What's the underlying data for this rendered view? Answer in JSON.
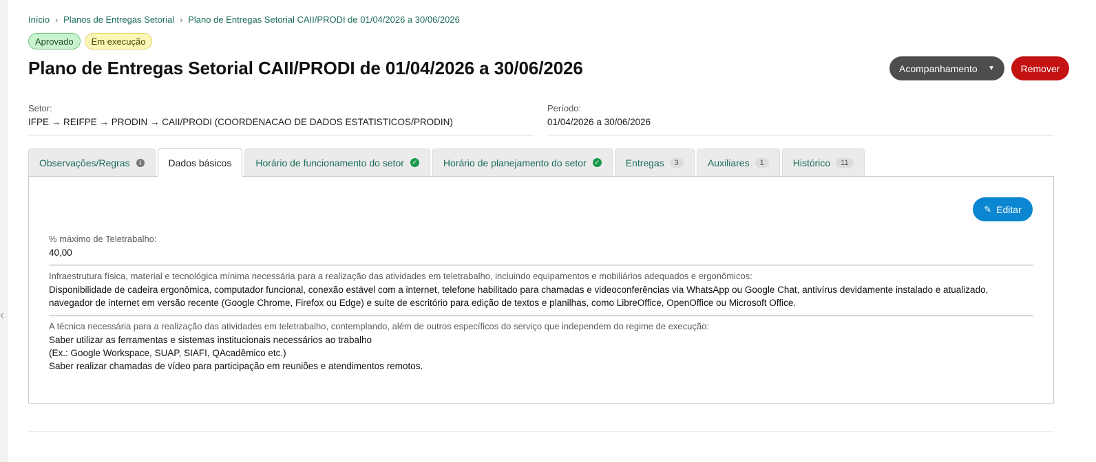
{
  "breadcrumb": {
    "items": [
      "Início",
      "Planos de Entregas Setorial",
      "Plano de Entregas Setorial CAII/PRODI de 01/04/2026 a 30/06/2026"
    ],
    "separator": "›"
  },
  "badges": [
    "Aprovado",
    "Em execução"
  ],
  "page_title": "Plano de Entregas Setorial CAII/PRODI de 01/04/2026 a 30/06/2026",
  "actions": {
    "acompanhamento": "Acompanhamento",
    "remover": "Remover"
  },
  "fields": {
    "setor_label": "Setor:",
    "setor_value": "IFPE → REIFPE → PRODIN → CAII/PRODI (COORDENACAO DE DADOS ESTATISTICOS/PRODIN)",
    "periodo_label": "Período:",
    "periodo_value": "01/04/2026 a 30/06/2026"
  },
  "tabs": {
    "observacoes": "Observações/Regras",
    "dados_basicos": "Dados básicos",
    "horario_funcionamento": "Horário de funcionamento do setor",
    "horario_planejamento": "Horário de planejamento do setor",
    "entregas": "Entregas",
    "entregas_count": "3",
    "auxiliares": "Auxiliares",
    "auxiliares_count": "1",
    "historico": "Histórico",
    "historico_count": "11",
    "active": "Dados básicos"
  },
  "panel": {
    "edit_label": "Editar",
    "teletrabalho_label": "% máximo de Teletrabalho:",
    "teletrabalho_value": "40,00",
    "infra_label": "Infraestrutura física, material e tecnológica mínima necessária para a realização das atividades em teletrabalho, incluindo equipamentos e mobiliários adequados e ergonômicos:",
    "infra_value": "Disponibilidade de cadeira ergonômica, computador funcional, conexão estável com a internet, telefone habilitado para chamadas e videoconferências via WhatsApp ou Google Chat, antivírus devidamente instalado e atualizado,\nnavegador de internet em versão recente (Google Chrome, Firefox ou Edge) e suíte de escritório para edição de textos e planilhas, como LibreOffice, OpenOffice ou Microsoft Office.",
    "tecnica_label": "A técnica necessária para a realização das atividades em teletrabalho, contemplando, além de outros específicos do serviço que independem do regime de execução:",
    "tecnica_value": "Saber utilizar as ferramentas e sistemas institucionais necessários ao trabalho\n(Ex.: Google Workspace, SUAP, SIAFI, QAcadêmico etc.)\nSaber realizar chamadas de vídeo para participação em reuniões e atendimentos remotos."
  },
  "icons": {
    "info": "info-circle-icon",
    "check": "check-circle-icon",
    "chevron": "chevron-down-icon",
    "edit": "edit-pen-icon",
    "collapse": "chevron-left-icon"
  },
  "colors": {
    "link": "#1a6b5a",
    "remove": "#c41212",
    "edit": "#0b86d1",
    "dark_button": "#4d4d4d",
    "badge_green": "#c9f2cf",
    "badge_yellow": "#fbf7b8",
    "check_green": "#1a9a4a"
  }
}
